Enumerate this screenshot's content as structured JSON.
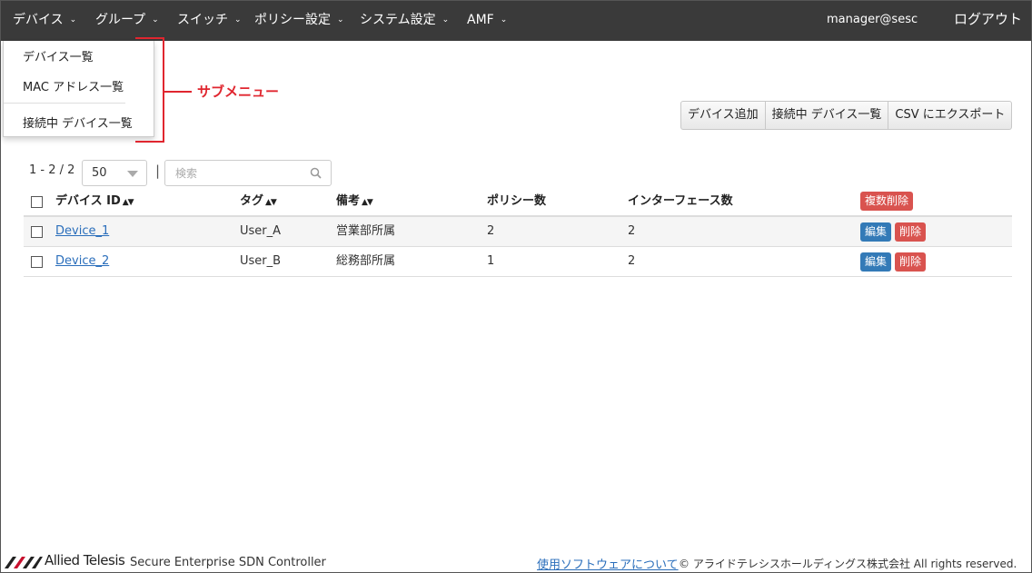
{
  "nav": {
    "items": [
      {
        "label": "デバイス"
      },
      {
        "label": "グループ"
      },
      {
        "label": "スイッチ"
      },
      {
        "label": "ポリシー設定"
      },
      {
        "label": "システム設定"
      },
      {
        "label": "AMF"
      }
    ],
    "user": "manager@sesc",
    "logout": "ログアウト"
  },
  "submenu": {
    "items": [
      "デバイス一覧",
      "MAC アドレス一覧",
      "接続中 デバイス一覧"
    ]
  },
  "annotation": {
    "label": "サブメニュー",
    "color": "#e0262f"
  },
  "toolbar": {
    "add_device": "デバイス追加",
    "connected_devices": "接続中 デバイス一覧",
    "csv_export": "CSV にエクスポート"
  },
  "pager": {
    "count": "1 - 2 / 2",
    "page_size": "50"
  },
  "search": {
    "placeholder": "検索"
  },
  "table": {
    "headers": {
      "device_id": "デバイス ID",
      "tag": "タグ",
      "note": "備考",
      "policy_count": "ポリシー数",
      "interface_count": "インターフェース数",
      "bulk_delete": "複数削除"
    },
    "rows": [
      {
        "device_id": "Device_1",
        "tag": "User_A",
        "note": "営業部所属",
        "policy_count": "2",
        "interface_count": "2",
        "edit": "編集",
        "delete": "削除"
      },
      {
        "device_id": "Device_2",
        "tag": "User_B",
        "note": "総務部所属",
        "policy_count": "1",
        "interface_count": "2",
        "edit": "編集",
        "delete": "削除"
      }
    ]
  },
  "footer": {
    "brand": "Allied Telesis",
    "product": "Secure Enterprise SDN Controller",
    "software_link": "使用ソフトウェアについて",
    "copyright": "© アライドテレシスホールディングス株式会社 All rights reserved."
  },
  "colors": {
    "navbar": "#3a3a3a",
    "primary": "#337ab7",
    "danger": "#d9534f",
    "link": "#2a6ebb"
  }
}
